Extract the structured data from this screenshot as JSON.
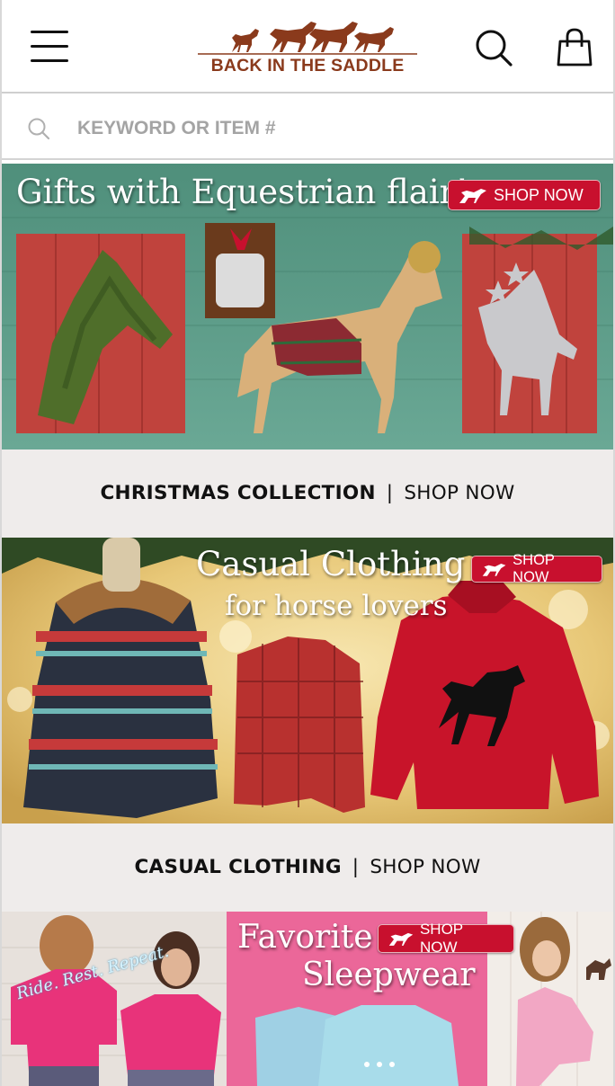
{
  "app": {
    "brand_name": "BACK IN THE SADDLE"
  },
  "header": {
    "menu_icon": "hamburger-menu-icon",
    "search_icon": "search-icon",
    "cart_icon": "shopping-bag-icon"
  },
  "search": {
    "placeholder": "KEYWORD OR ITEM #"
  },
  "banners": [
    {
      "headline": "Gifts with Equestrian flair!",
      "badge": "SHOP NOW",
      "caption_bold": "CHRISTMAS COLLECTION",
      "caption_sep": "|",
      "caption_link": "SHOP NOW"
    },
    {
      "headline_line1": "Casual Clothing",
      "headline_line2": "for horse lovers",
      "badge": "SHOP NOW",
      "caption_bold": "CASUAL CLOTHING",
      "caption_sep": "|",
      "caption_link": "SHOP NOW"
    },
    {
      "headline_line1": "Favorite",
      "headline_line2": "Sleepwear",
      "badge": "SHOP NOW",
      "shirt_text": "Ride. Rest. Repeat."
    }
  ],
  "colors": {
    "brand_brown": "#8a3a1c",
    "badge_red": "#c8102e",
    "caption_bg": "#efeceb",
    "banner1_green": "#5f9e88",
    "banner2_gold": "#e8c878",
    "banner3_pink": "#e8558e"
  }
}
